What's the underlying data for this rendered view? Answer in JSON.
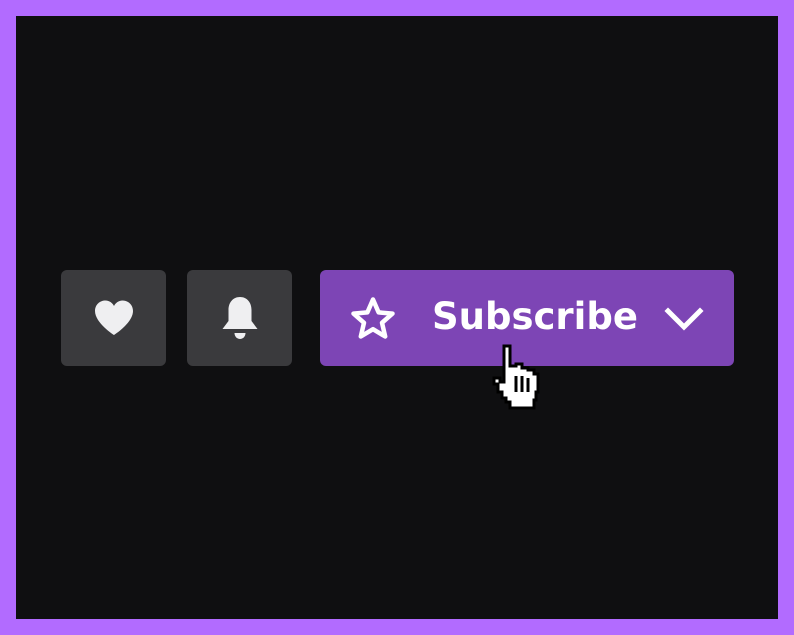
{
  "buttons": {
    "follow": {
      "icon": "heart-icon"
    },
    "notifications": {
      "icon": "bell-icon"
    },
    "subscribe": {
      "label": "Subscribe",
      "icon": "star-icon",
      "dropdown_icon": "chevron-down-icon"
    }
  },
  "cursor": {
    "icon": "hand-pointer-cursor-icon"
  },
  "colors": {
    "outer_border": "#b26bff",
    "background": "#0f0f11",
    "secondary_button": "#3a3a3d",
    "accent": "#7d45b5",
    "icon": "#efeff1"
  }
}
